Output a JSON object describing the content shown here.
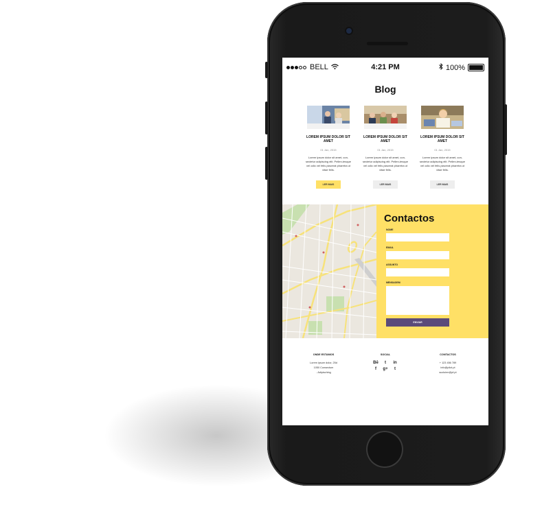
{
  "status_bar": {
    "carrier": "BELL",
    "time": "4:21 PM",
    "battery": "100%"
  },
  "blog": {
    "title": "Blog",
    "posts": [
      {
        "title": "LOREM IPSUM DOLOR SIT AMET",
        "date": "01 Jan, 2015",
        "excerpt": "Lorem ipsum dolor sit amet, con-sectetur adipiscing elit. Pellen-tesque vel odio vel felis placerat pharetra ut vitae felis.",
        "button": "LER MAIS",
        "button_active": true
      },
      {
        "title": "LOREM IPSUM DOLOR SIT AMET",
        "date": "01 Jan, 2015",
        "excerpt": "Lorem ipsum dolor sit amet, con-sectetur adipiscing elit. Pellen-tesque vel odio vel felis placerat pharetra ut vitae felis.",
        "button": "LER MAIS",
        "button_active": false
      },
      {
        "title": "LOREM IPSUM DOLOR SIT AMET",
        "date": "01 Jan, 2015",
        "excerpt": "Lorem ipsum dolor sit amet, con-sectetur adipiscing elit. Pellen-tesque vel odio vel felis placerat pharetra ut vitae felis.",
        "button": "LER MAIS",
        "button_active": false
      }
    ]
  },
  "contact": {
    "title": "Contactos",
    "fields": {
      "name": "NOME",
      "email": "EMAIL",
      "subject": "ASSUNTO",
      "message": "MENSAGEM"
    },
    "send_label": "ENVIAR",
    "accent": "#ffe066",
    "button_color": "#5b4a7a"
  },
  "footer": {
    "where": {
      "heading": "ONDE ESTAMOS",
      "lines": [
        "Lorem ipsum dolor, 25d",
        "1050 Consectum",
        "- Adipisching"
      ]
    },
    "social": {
      "heading": "SOCIAL",
      "icons": [
        "behance-icon",
        "twitter-icon",
        "linkedin-icon",
        "facebook-icon",
        "google-plus-icon",
        "tumblr-icon"
      ],
      "glyphs": [
        "Bē",
        "t",
        "in",
        "f",
        "g+",
        "t"
      ]
    },
    "contacts": {
      "heading": "CONTACTOS",
      "lines": [
        "+ 123 456 789",
        "info@pilot.pt",
        "sucluinn@pf.pt"
      ]
    }
  }
}
